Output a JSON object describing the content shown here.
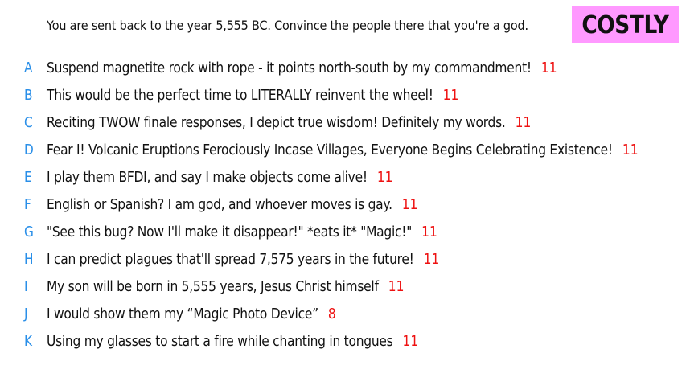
{
  "prompt": "You are sent back to the year 5,555 BC. Convince the people there that you're a god.",
  "badge": {
    "label": "COSTLY",
    "color": "#ff99ff"
  },
  "colors": {
    "letter": "#2a8fe8",
    "count": "#ee1111",
    "text": "#111111"
  },
  "responses": [
    {
      "letter": "A",
      "text": "Suspend magnetite rock with rope - it points north-south by my commandment!",
      "count": "11"
    },
    {
      "letter": "B",
      "text": "This would be the perfect time to LITERALLY reinvent the wheel!",
      "count": "11"
    },
    {
      "letter": "C",
      "text": "Reciting TWOW finale responses, I depict true wisdom! Definitely my words.",
      "count": "11"
    },
    {
      "letter": "D",
      "text": "Fear I! Volcanic Eruptions Ferociously Incase Villages, Everyone Begins Celebrating Existence!",
      "count": "11"
    },
    {
      "letter": "E",
      "text": "I play them BFDI, and say I make objects come alive!",
      "count": "11"
    },
    {
      "letter": "F",
      "text": "English or Spanish? I am god, and whoever moves is gay.",
      "count": "11"
    },
    {
      "letter": "G",
      "text": "\"See this bug? Now I'll make it disappear!\" *eats it* \"Magic!\"",
      "count": "11"
    },
    {
      "letter": "H",
      "text": "I can predict plagues that'll spread 7,575 years in the future!",
      "count": "11"
    },
    {
      "letter": "I",
      "text": "My son will be born in 5,555 years, Jesus Christ himself",
      "count": "11"
    },
    {
      "letter": "J",
      "text": "I would show them my “Magic Photo Device”",
      "count": "8"
    },
    {
      "letter": "K",
      "text": "Using my glasses to start a fire while chanting in tongues",
      "count": "11"
    }
  ]
}
